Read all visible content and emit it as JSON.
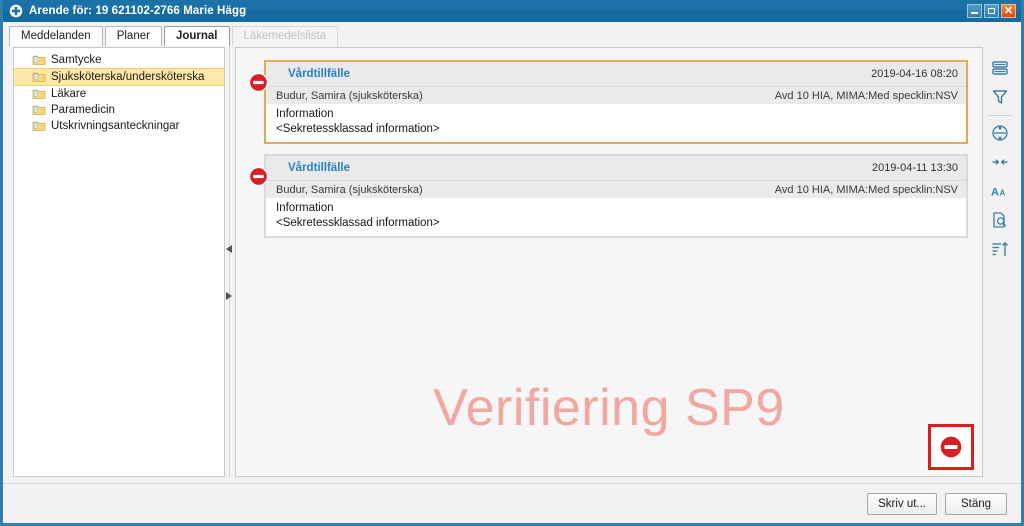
{
  "window": {
    "title": "Ärende för: 19 621102-2766 Marie Hägg",
    "title_icon": "medical-cross-icon",
    "controls": {
      "minimize": "minimize-icon",
      "maximize": "maximize-icon",
      "close": "close-icon"
    }
  },
  "tabs": [
    {
      "label": "Meddelanden",
      "state": "normal"
    },
    {
      "label": "Planer",
      "state": "normal"
    },
    {
      "label": "Journal",
      "state": "active"
    },
    {
      "label": "Läkemedelslista",
      "state": "disabled"
    }
  ],
  "sidebar": {
    "items": [
      {
        "label": "Samtycke",
        "icon": "folder-icon",
        "selected": false
      },
      {
        "label": "Sjuksköterska/undersköterska",
        "icon": "folder-icon",
        "selected": true
      },
      {
        "label": "Läkare",
        "icon": "folder-icon",
        "selected": false
      },
      {
        "label": "Paramedicin",
        "icon": "folder-icon",
        "selected": false
      },
      {
        "label": "Utskrivningsanteckningar",
        "icon": "folder-icon",
        "selected": false
      }
    ]
  },
  "splitter": {
    "collapse_left_icon": "triangle-left-icon",
    "expand_right_icon": "triangle-right-icon"
  },
  "records": [
    {
      "status_icon": "deny-icon",
      "title": "Vårdtillfälle",
      "date": "2019-04-16 08:20",
      "author": "Budur, Samira (sjuksköterska)",
      "unit": "Avd 10 HIA, MIMA:Med specklin:NSV",
      "section_label": "Information",
      "section_value": "<Sekretessklassad information>",
      "selected": true
    },
    {
      "status_icon": "deny-icon",
      "title": "Vårdtillfälle",
      "date": "2019-04-11 13:30",
      "author": "Budur, Samira (sjuksköterska)",
      "unit": "Avd 10 HIA, MIMA:Med specklin:NSV",
      "section_label": "Information",
      "section_value": "<Sekretessklassad information>",
      "selected": false
    }
  ],
  "watermark": {
    "text": "Verifiering SP9",
    "color": "#f2a8a0"
  },
  "annotation": {
    "icon": "deny-icon",
    "border_color": "#e01b1b"
  },
  "right_toolbar": {
    "items": [
      {
        "icon": "list-rows-icon"
      },
      {
        "icon": "filter-funnel-icon"
      },
      {
        "icon": "expand-all-icon"
      },
      {
        "icon": "collapse-all-icon"
      },
      {
        "icon": "font-size-icon"
      },
      {
        "icon": "search-document-icon"
      },
      {
        "icon": "sort-ascending-icon"
      }
    ]
  },
  "footer": {
    "print_label": "Skriv ut...",
    "close_label": "Stäng"
  },
  "colors": {
    "titlebar": "#1a72a8",
    "selection": "#ffe8a8",
    "card_selected_border": "#e0a95c",
    "link": "#2b7fc4",
    "deny_red": "#d81f26"
  }
}
